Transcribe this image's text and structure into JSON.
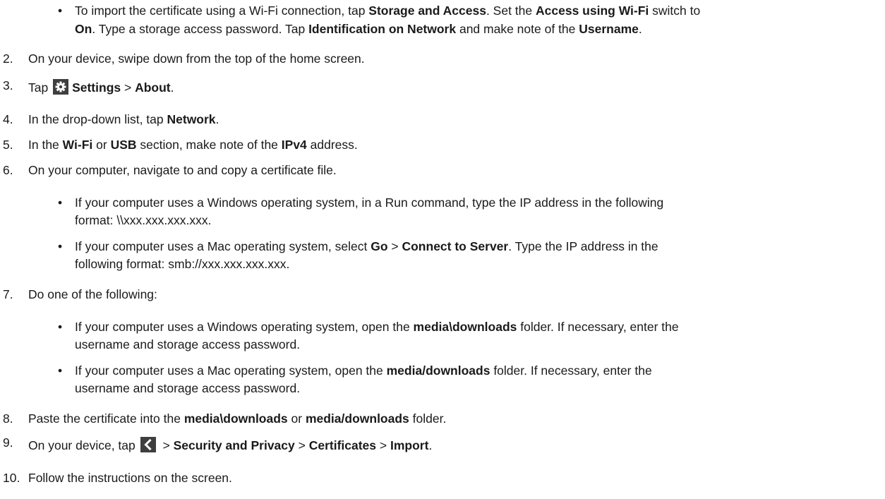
{
  "bullet_char": "•",
  "top_bullet": {
    "line1_pre": "To import the certificate using a Wi-Fi connection, tap ",
    "b1": "Storage and Access",
    "m1": ". Set the ",
    "b2": "Access using Wi-Fi",
    "m2": " switch to",
    "b3": "On",
    "m3": ". Type a storage access password. Tap ",
    "b4": "Identification on Network",
    "m4": " and make note of the ",
    "b5": "Username",
    "end": "."
  },
  "step2": {
    "num": "2.",
    "text": "On your device, swipe down from the top of the home screen."
  },
  "step3": {
    "num": "3.",
    "pre": "Tap ",
    "icon": "gear-icon",
    "b1": "Settings",
    "sep": " > ",
    "b2": "About",
    "end": "."
  },
  "step4": {
    "num": "4.",
    "pre": "In the drop-down list, tap ",
    "b1": "Network",
    "end": "."
  },
  "step5": {
    "num": "5.",
    "pre": "In the ",
    "b1": "Wi-Fi",
    "m1": " or ",
    "b2": "USB",
    "m2": " section, make note of the ",
    "b3": "IPv4",
    "end": " address."
  },
  "step6": {
    "num": "6.",
    "text": "On your computer, navigate to and copy a certificate file.",
    "bullet1_l1": "If your computer uses a Windows operating system, in a Run command, type the IP address in the following",
    "bullet1_l2": "format: \\\\xxx.xxx.xxx.xxx.",
    "bullet2_pre": "If your computer uses a Mac operating system, select ",
    "bullet2_b1": "Go",
    "bullet2_sep": " > ",
    "bullet2_b2": "Connect to Server",
    "bullet2_post": ". Type the IP address in the",
    "bullet2_l2": "following format: smb://xxx.xxx.xxx.xxx."
  },
  "step7": {
    "num": "7.",
    "text": "Do one of the following:",
    "bullet1_pre": "If your computer uses a Windows operating system, open the ",
    "bullet1_b": "media\\downloads",
    "bullet1_post": " folder. If necessary, enter the",
    "bullet1_l2": "username and storage access password.",
    "bullet2_pre": "If your computer uses a Mac operating system, open the ",
    "bullet2_b": "media/downloads",
    "bullet2_post": " folder. If necessary, enter the",
    "bullet2_l2": "username and storage access password."
  },
  "step8": {
    "num": "8.",
    "pre": "Paste the certificate into the ",
    "b1": "media\\downloads",
    "m1": " or ",
    "b2": "media/downloads",
    "end": " folder."
  },
  "step9": {
    "num": "9.",
    "pre": "On your device, tap ",
    "icon": "back-chevron-icon",
    "sep0": " > ",
    "b1": "Security and Privacy",
    "sep1": " > ",
    "b2": "Certificates",
    "sep2": " > ",
    "b3": "Import",
    "end": "."
  },
  "step10": {
    "num": "10.",
    "text": "Follow the instructions on the screen."
  }
}
